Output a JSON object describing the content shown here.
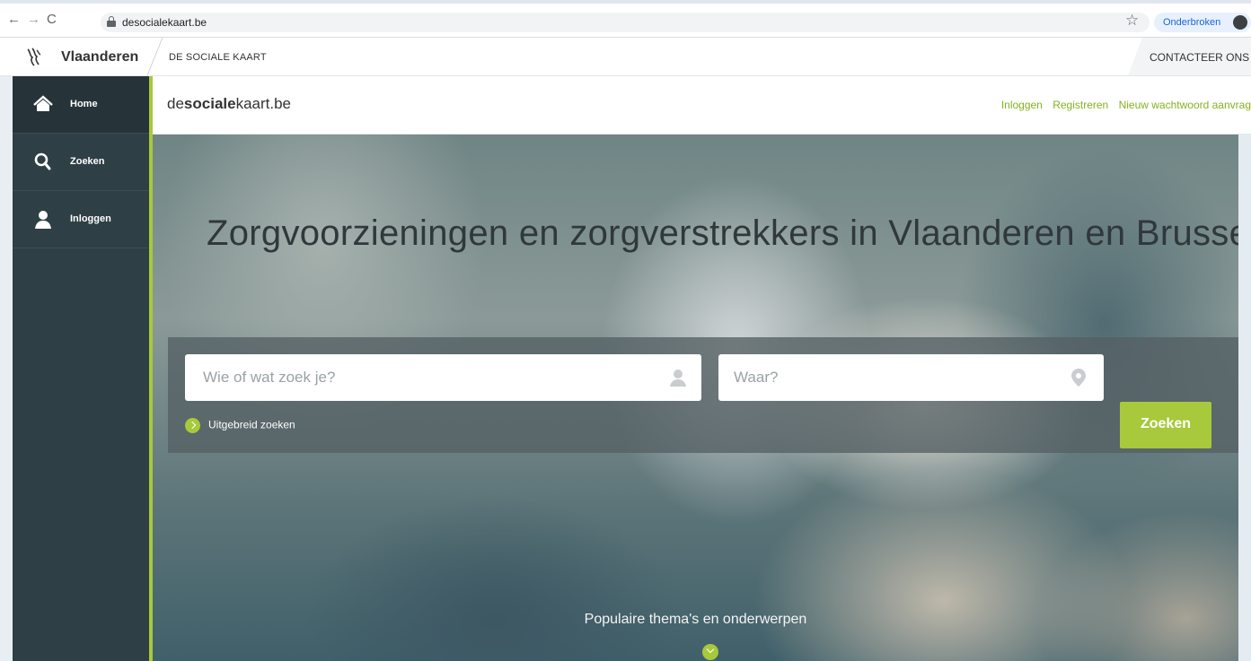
{
  "browser": {
    "url": "desocialekaart.be",
    "profile_label": "Onderbroken",
    "back_icon": "arrow-left-icon",
    "forward_icon": "arrow-right-icon",
    "reload_icon": "reload-icon",
    "bookmark_icon": "star-icon"
  },
  "vlaanderen_bar": {
    "brand": "Vlaanderen",
    "section": "DE SOCIALE KAART",
    "contact": "CONTACTEER ONS"
  },
  "sidebar": {
    "items": [
      {
        "label": "Home",
        "icon": "home-icon"
      },
      {
        "label": "Zoeken",
        "icon": "search-icon"
      },
      {
        "label": "Inloggen",
        "icon": "user-icon"
      }
    ]
  },
  "header": {
    "logo_prefix": "de",
    "logo_bold": "sociale",
    "logo_suffix": "kaart.be",
    "links": [
      "Inloggen",
      "Registreren",
      "Nieuw wachtwoord aanvrag"
    ]
  },
  "hero": {
    "title": "Zorgvoorzieningen en zorgverstrekkers in Vlaanderen en Brussel",
    "who_placeholder": "Wie of wat zoek je?",
    "where_placeholder": "Waar?",
    "advanced_search": "Uitgebreid zoeken",
    "search_button": "Zoeken",
    "popular_label": "Populaire thema's en onderwerpen"
  },
  "colors": {
    "accent": "#a7c93b",
    "sidebar": "#2e3f45",
    "link": "#84b21f"
  }
}
